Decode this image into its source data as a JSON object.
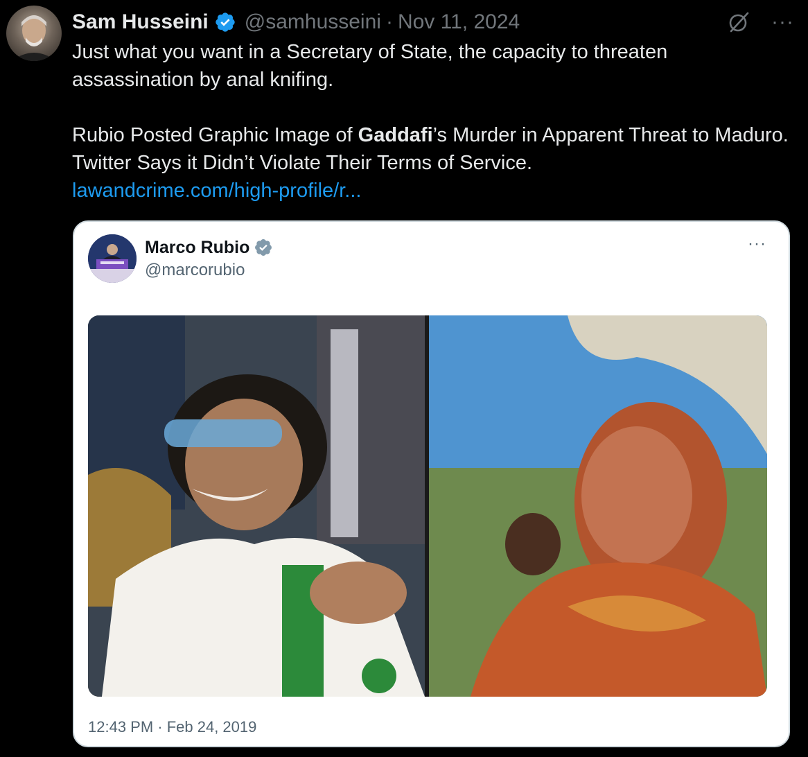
{
  "tweet": {
    "author_name": "Sam Husseini",
    "handle": "@samhusseini",
    "separator": "·",
    "date": "Nov 11, 2024",
    "more_label": "···",
    "text_line1": "Just what you want in a Secretary of State, the capacity to threaten assassination by anal knifing.",
    "text_pre": "Rubio Posted Graphic Image of ",
    "text_bold": "Gaddafi",
    "text_post": "’s Murder in Apparent Threat to Maduro. Twitter Says it Didn’t Violate Their Terms of Service.",
    "link": "lawandcrime.com/high-profile/r..."
  },
  "quote": {
    "author_name": "Marco Rubio",
    "handle": "@marcorubio",
    "more_label": "···",
    "timestamp": "12:43 PM · Feb 24, 2019"
  },
  "colors": {
    "background": "#000000",
    "text_primary": "#e7e9ea",
    "text_secondary": "#71767b",
    "link": "#1d9bf0",
    "verified": "#1d9bf0",
    "quote_background": "#ffffff",
    "quote_verified": "#829aab"
  },
  "icons": [
    "verified-badge-icon",
    "grok-icon",
    "more-options-icon"
  ]
}
